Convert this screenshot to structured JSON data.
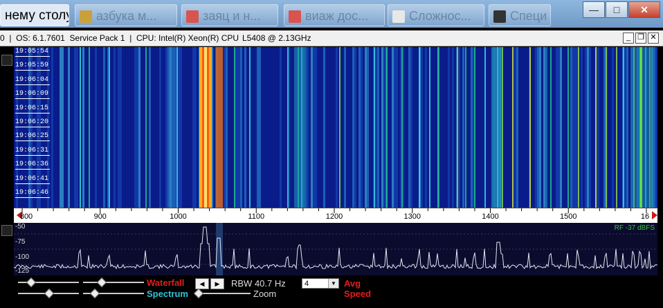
{
  "taskbar": {
    "items": [
      {
        "label": "нему столу",
        "icon": "desktop-icon"
      },
      {
        "label": "азбука м...",
        "icon": "image-icon"
      },
      {
        "label": "заяц и н...",
        "icon": "document-icon"
      },
      {
        "label": "виаж дос...",
        "icon": "document-icon"
      },
      {
        "label": "Сложнос...",
        "icon": "image-icon"
      },
      {
        "label": "Специ",
        "icon": "app-icon"
      }
    ],
    "minimize": "—",
    "maximize": "□",
    "close": "✕"
  },
  "infobar": {
    "text": "0  |  OS: 6.1.7601  Service Pack 1  |  CPU: Intel(R) Xeon(R) CPU",
    "cpu_model": "L5408  @ 2.13GHz",
    "mdi_minimize": "_",
    "mdi_restore": "❐",
    "mdi_close": "✕"
  },
  "waterfall": {
    "times": [
      "19:05:54",
      "19:05:59",
      "19:06:04",
      "19:06:09",
      "19:06:15",
      "19:06:20",
      "19:06:25",
      "19:06:31",
      "19:06:36",
      "19:06:41",
      "19:06:46"
    ]
  },
  "freq_axis": {
    "labels": [
      "800",
      "900",
      "1000",
      "1100",
      "1200",
      "1300",
      "1400",
      "1500",
      "16"
    ]
  },
  "spectrum": {
    "db_labels": [
      "-50",
      "-75",
      "-100",
      "-125"
    ],
    "rf_label": "RF -37 dBFS"
  },
  "controls": {
    "waterfall_label": "Waterfall",
    "spectrum_label": "Spectrum",
    "rbw_label": "RBW 40.7 Hz",
    "zoom_label": "Zoom",
    "avg_value": "4",
    "avg_label": "Avg",
    "speed_label": "Speed",
    "left_arrow": "◀",
    "right_arrow": "▶",
    "dropdown": "▼"
  },
  "colors": {
    "waterfall_bg": "#0b1a7a",
    "hot_signal": "#ff8c00",
    "trace": "#e6e6f0",
    "label_red": "#e51c1c",
    "label_cyan": "#2dc6d6",
    "rf_green": "#2ec82e"
  }
}
